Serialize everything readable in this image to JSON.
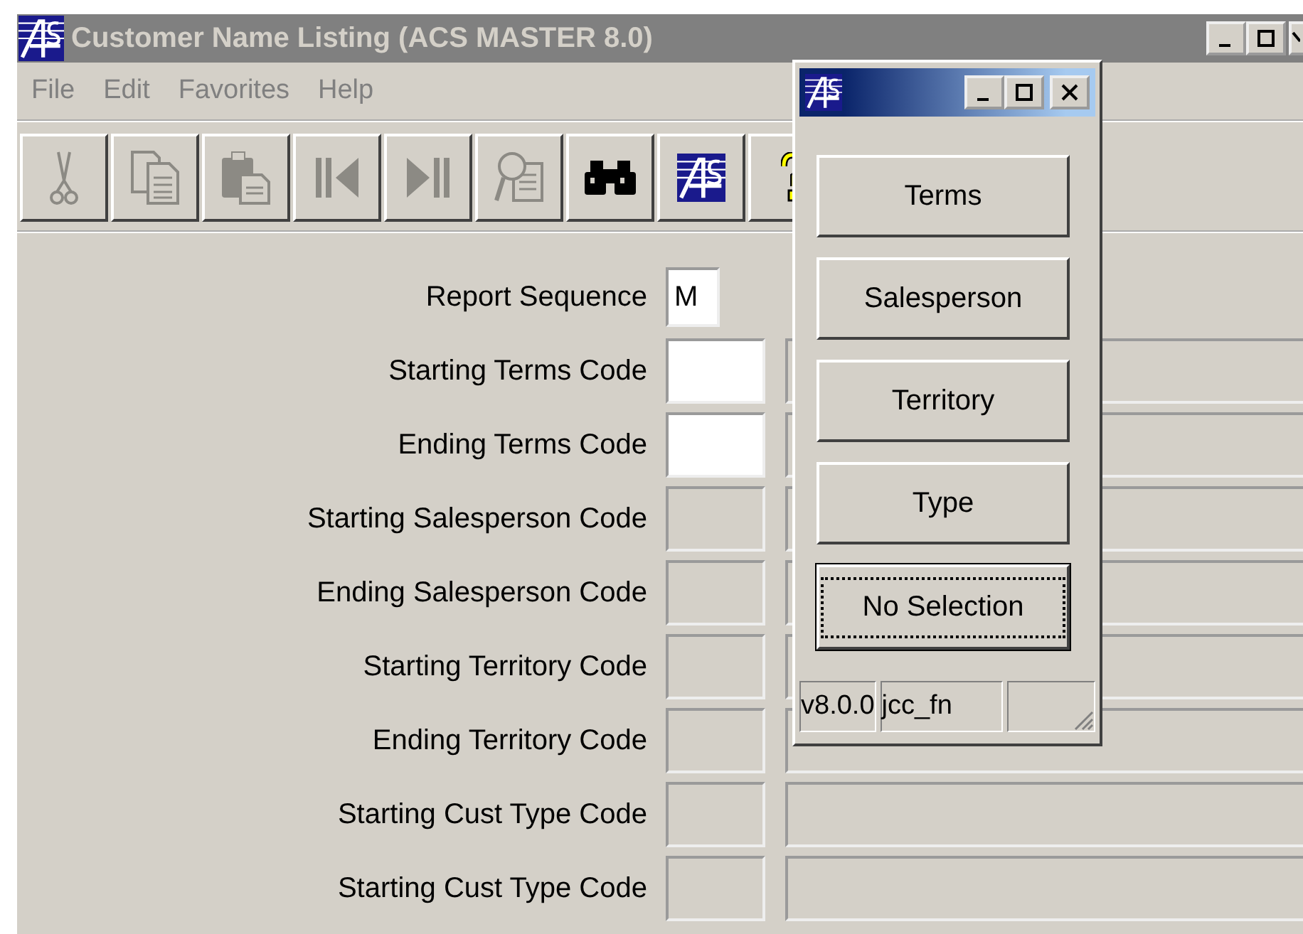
{
  "window": {
    "title": "Customer Name Listing (ACS MASTER 8.0)",
    "active": false
  },
  "menu": [
    {
      "label": "File",
      "disabled": true
    },
    {
      "label": "Edit",
      "disabled": true
    },
    {
      "label": "Favorites",
      "disabled": true
    },
    {
      "label": "Help",
      "disabled": true
    }
  ],
  "toolbar": [
    {
      "kind": "cut",
      "disabled": true
    },
    {
      "kind": "copy",
      "disabled": true
    },
    {
      "kind": "paste",
      "disabled": true
    },
    {
      "kind": "first",
      "disabled": true
    },
    {
      "kind": "last",
      "disabled": true
    },
    {
      "kind": "lookup",
      "disabled": true
    },
    {
      "kind": "binoculars",
      "disabled": false
    },
    {
      "kind": "logo",
      "disabled": false
    },
    {
      "kind": "help",
      "disabled": false
    }
  ],
  "form": {
    "rows": [
      {
        "label": "Report Sequence",
        "kind": "sequence",
        "value": "M",
        "disabled": false
      },
      {
        "label": "Starting Terms Code",
        "kind": "code",
        "disabled": false
      },
      {
        "label": "Ending Terms Code",
        "kind": "code",
        "disabled": false
      },
      {
        "label": "Starting Salesperson Code",
        "kind": "code",
        "disabled": true
      },
      {
        "label": "Ending Salesperson Code",
        "kind": "code",
        "disabled": true
      },
      {
        "label": "Starting Territory Code",
        "kind": "code",
        "disabled": true
      },
      {
        "label": "Ending Territory Code",
        "kind": "code",
        "disabled": true
      },
      {
        "label": "Starting Cust Type Code",
        "kind": "code",
        "disabled": true
      },
      {
        "label": "Starting Cust Type Code",
        "kind": "code",
        "disabled": true
      }
    ]
  },
  "popup": {
    "buttons": [
      {
        "label": "Terms",
        "default": false
      },
      {
        "label": "Salesperson",
        "default": false
      },
      {
        "label": "Territory",
        "default": false
      },
      {
        "label": "Type",
        "default": false
      },
      {
        "label": "No Selection",
        "default": true
      }
    ],
    "status_bar": [
      "v8.0.0",
      "jcc_fn"
    ]
  }
}
